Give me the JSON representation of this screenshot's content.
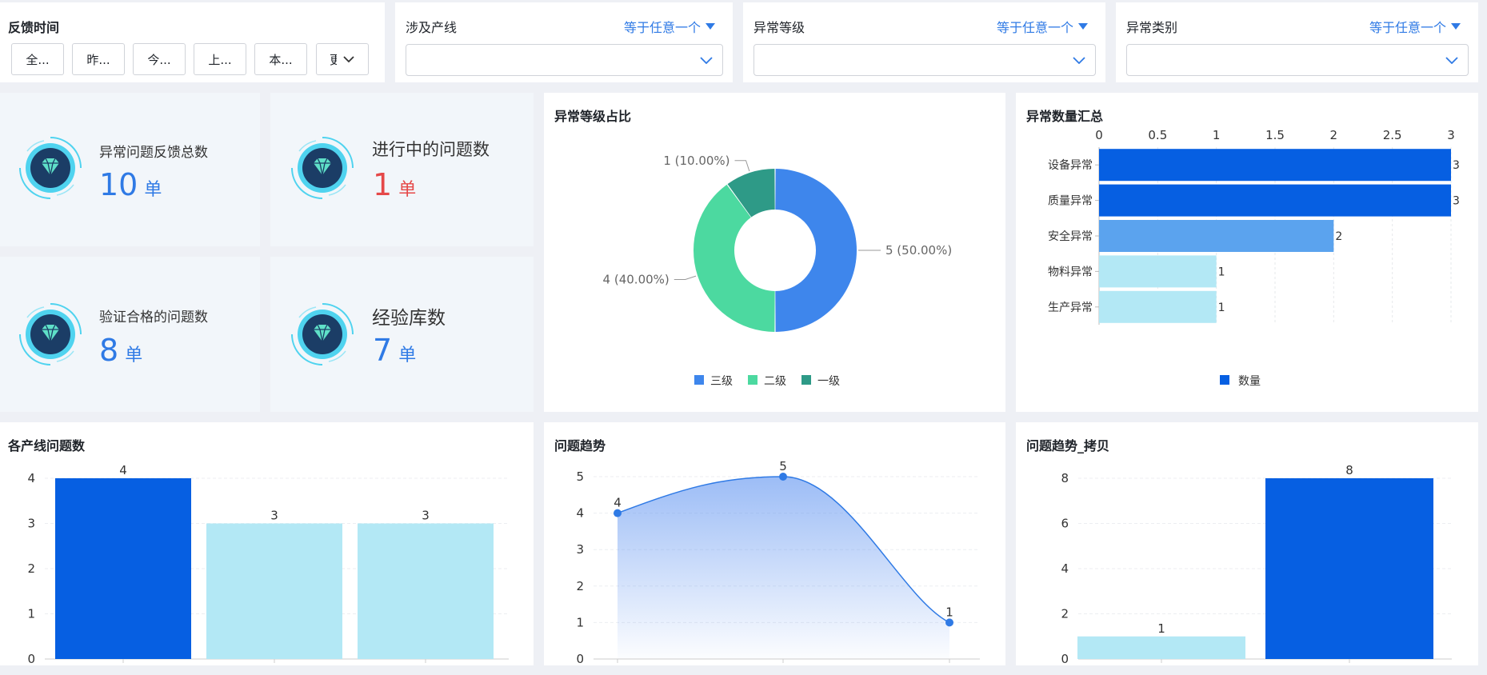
{
  "filters": {
    "time": {
      "label": "反馈时间",
      "buttons": [
        "全...",
        "昨...",
        "今...",
        "上...",
        "本..."
      ],
      "more_label": "更"
    },
    "line": {
      "label": "涉及产线",
      "operator": "等于任意一个"
    },
    "level": {
      "label": "异常等级",
      "operator": "等于任意一个"
    },
    "category": {
      "label": "异常类别",
      "operator": "等于任意一个"
    }
  },
  "stats": {
    "total": {
      "label": "异常问题反馈总数",
      "value": "10",
      "unit": "单"
    },
    "in_progress": {
      "label": "进行中的问题数",
      "value": "1",
      "unit": "单"
    },
    "verified": {
      "label": "验证合格的问题数",
      "value": "8",
      "unit": "单"
    },
    "experience": {
      "label": "经验库数",
      "value": "7",
      "unit": "单"
    }
  },
  "colors": {
    "primary_blue": "#065fe2",
    "light_blue": "#b3e8f5",
    "mid_blue": "#5ba3ee",
    "donut_level3": "#3e86ec",
    "donut_level2": "#4cd9a0",
    "donut_level1": "#2e9a87",
    "accent_red": "#e54848"
  },
  "chart_data": [
    {
      "id": "level-ratio",
      "type": "pie",
      "title": "异常等级占比",
      "donut": true,
      "slices": [
        {
          "name": "三级",
          "value": 5,
          "label": "5 (50.00%)"
        },
        {
          "name": "二级",
          "value": 4,
          "label": "4 (40.00%)"
        },
        {
          "name": "一级",
          "value": 1,
          "label": "1 (10.00%)"
        }
      ],
      "legend": [
        "三级",
        "二级",
        "一级"
      ],
      "legend_position": "bottom"
    },
    {
      "id": "category-summary",
      "type": "bar",
      "orientation": "horizontal",
      "title": "异常数量汇总",
      "categories": [
        "设备异常",
        "质量异常",
        "安全异常",
        "物料异常",
        "生产异常"
      ],
      "values": [
        3,
        3,
        2,
        1,
        1
      ],
      "series": [
        {
          "name": "数量",
          "values": [
            3,
            3,
            2,
            1,
            1
          ]
        }
      ],
      "xlim": [
        0,
        3
      ],
      "xticks": [
        "0",
        "0.5",
        "1",
        "1.5",
        "2",
        "2.5",
        "3"
      ],
      "axis_position": "top",
      "legend_position": "bottom",
      "grid": true
    },
    {
      "id": "line-issues",
      "type": "bar",
      "title": "各产线问题数",
      "values": [
        4,
        3,
        3
      ],
      "data_labels": [
        "4",
        "3",
        "3"
      ],
      "ylim": [
        0,
        4
      ],
      "yticks": [
        "0",
        "1",
        "2",
        "3",
        "4"
      ],
      "grid": true
    },
    {
      "id": "trend",
      "type": "area",
      "title": "问题趋势",
      "values": [
        4,
        5,
        1
      ],
      "data_labels": [
        "4",
        "5",
        "1"
      ],
      "ylim": [
        0,
        5
      ],
      "yticks": [
        "0",
        "1",
        "2",
        "3",
        "4",
        "5"
      ],
      "smooth": true,
      "grid": true
    },
    {
      "id": "trend-copy",
      "type": "bar",
      "title": "问题趋势_拷贝",
      "values": [
        1,
        8
      ],
      "data_labels": [
        "1",
        "8"
      ],
      "ylim": [
        0,
        8
      ],
      "yticks": [
        "0",
        "2",
        "4",
        "6",
        "8"
      ],
      "grid": true
    }
  ]
}
